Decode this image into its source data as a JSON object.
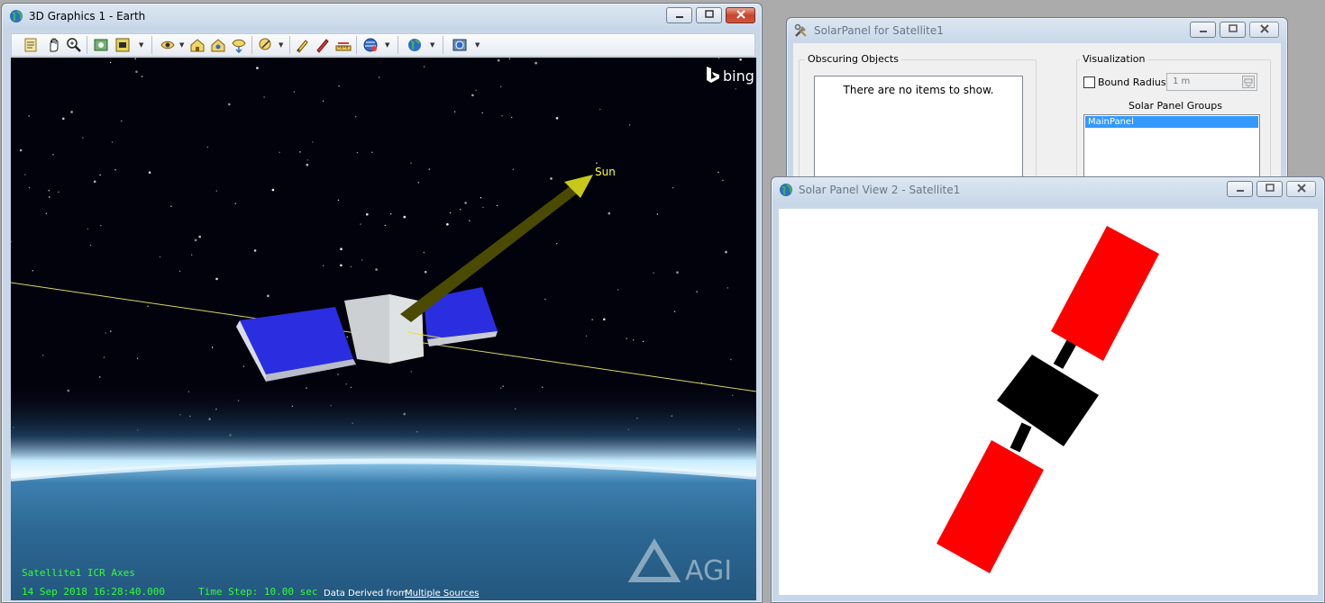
{
  "graphics_window": {
    "title": "3D Graphics 1 - Earth",
    "bing_label": "bing",
    "sun_label": "Sun",
    "hud_line1": "Satellite1 ICR Axes",
    "hud_date": "14 Sep 2018 16:28:40.000",
    "hud_timestep": "Time Step: 10.00 sec",
    "attribution_prefix": "Data Derived from",
    "attribution_link": "Multiple Sources",
    "agi_logo": "AGI",
    "toolbar_icons": [
      "properties-icon",
      "pan-icon",
      "zoom-icon",
      "view-icon",
      "screenshot-icon",
      "eye-view-icon",
      "home-view-icon",
      "objects-view-icon",
      "look-at-icon",
      "measure-icon",
      "brush-icon",
      "pencil-icon",
      "ruler-icon",
      "globe-icon",
      "earth-icon",
      "map-icon"
    ]
  },
  "solar_panel_tool": {
    "title": "SolarPanel for Satellite1",
    "obscuring_label": "Obscuring Objects",
    "empty_text": "There are no items to show.",
    "visualization_label": "Visualization",
    "bound_radius_label": "Bound Radius:",
    "bound_radius_value": "1 m",
    "groups_label": "Solar Panel Groups",
    "groups": [
      "MainPanel"
    ]
  },
  "solar_panel_view": {
    "title": "Solar Panel View 2 - Satellite1"
  },
  "colors": {
    "panel_blue": "#2a2ee0",
    "panel_red": "#ff0000",
    "selection": "#3399ff",
    "hud_green": "#33ff33",
    "sun_yellow": "#ffff33"
  }
}
